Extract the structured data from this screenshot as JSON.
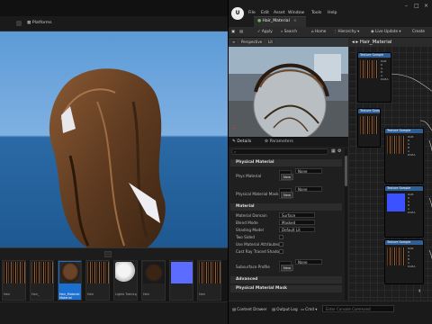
{
  "background_editor": {
    "platforms_label": "Platforms",
    "content_browser": {
      "thumbnails": [
        {
          "label": "Hair",
          "style": "strands"
        },
        {
          "label": "Hair_",
          "style": "strands"
        },
        {
          "label": "Hair_Material",
          "sub": "Material",
          "style": "hair",
          "selected": true
        },
        {
          "label": "Hair",
          "style": "strands"
        },
        {
          "label": "Lights Training",
          "style": "sphere"
        },
        {
          "label": "Hair",
          "style": "hairdark"
        },
        {
          "label": "",
          "style": "blue"
        },
        {
          "label": "Hair",
          "style": "strands"
        }
      ]
    }
  },
  "material_editor": {
    "menu": [
      "File",
      "Edit",
      "Asset",
      "Window",
      "Tools",
      "Help"
    ],
    "document_tab": "Hair_Material",
    "toolbar": {
      "apply": "Apply",
      "search": "Search",
      "home": "Home",
      "hierarchy": "Hierarchy",
      "live_update": "Live Update",
      "create": "Create"
    },
    "preview": {
      "perspective": "Perspective",
      "lit": "Lit"
    },
    "details": {
      "tab_details": "Details",
      "tab_parameters": "Parameters",
      "categories": {
        "physical_material": "Physical Material",
        "material": "Material",
        "advanced": "Advanced",
        "physical_material_mask": "Physical Material Mask"
      },
      "props": {
        "phys_material": "Phys Material",
        "phys_material_value": "None",
        "phys_material_mask": "Physical Material Mask",
        "phys_material_mask_value": "None",
        "material_domain": "Material Domain",
        "material_domain_value": "Surface",
        "blend_mode": "Blend Mode",
        "blend_mode_value": "Masked",
        "shading_model": "Shading Model",
        "shading_model_value": "Default Lit",
        "two_sided": "Two Sided",
        "use_material_attributes": "Use Material Attributes",
        "cast_ray_traced_shadows": "Cast Ray Traced Shado...",
        "subsurface_profile": "Subsurface Profile",
        "subsurface_profile_value": "None"
      },
      "new_label": "New"
    },
    "graph": {
      "title": "Hair_Material",
      "nodes": [
        {
          "title": "Texture Sample",
          "style": "strands",
          "pins": [
            "RGB",
            "R",
            "G",
            "B",
            "A",
            "RGBA"
          ]
        },
        {
          "title": "Texture Sample",
          "style": "strands",
          "pins": [
            "RGB",
            "R",
            "G",
            "B",
            "A",
            "RGBA"
          ]
        },
        {
          "title": "Texture Sample",
          "style": "strands",
          "pins": [
            "RGB",
            "R",
            "G",
            "B",
            "A",
            "RGBA"
          ]
        },
        {
          "title": "Texture Sample",
          "style": "blue",
          "pins": [
            "RGB",
            "R",
            "G",
            "B",
            "A",
            "RGBA"
          ]
        },
        {
          "title": "Texture Sample",
          "style": "strands",
          "pins": [
            "RGB",
            "R",
            "G",
            "B",
            "A",
            "RGBA"
          ]
        }
      ]
    },
    "status_bar": {
      "content_drawer": "Content Drawer",
      "output_log": "Output Log",
      "cmd": "Cmd",
      "console_placeholder": "Enter Console Command"
    }
  }
}
